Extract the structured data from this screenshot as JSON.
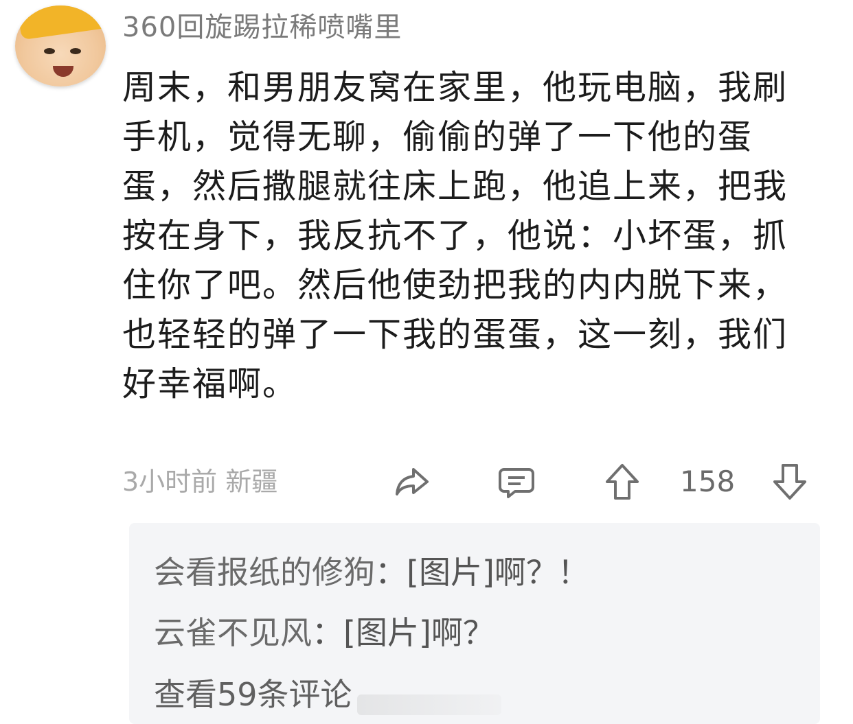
{
  "post": {
    "username": "360回旋踢拉稀喷嘴里",
    "text": "周末，和男朋友窝在家里，他玩电脑，我刷手机，觉得无聊，偷偷的弹了一下他的蛋蛋，然后撒腿就往床上跑，他追上来，把我按在身下，我反抗不了，他说：小坏蛋，抓住你了吧。然后他使劲把我的内内脱下来，也轻轻的弹了一下我的蛋蛋，这一刻，我们好幸福啊。",
    "time_location": "3小时前 新疆",
    "upvote_count": "158"
  },
  "icons": {
    "share": "share-arrow-icon",
    "comment": "comment-bubble-icon",
    "upvote": "up-arrow-icon",
    "downvote": "down-arrow-icon"
  },
  "comments": [
    {
      "author": "会看报纸的修狗",
      "separator": "：",
      "content": "[图片]啊？！"
    },
    {
      "author": "云雀不见风",
      "separator": "：",
      "content": "[图片]啊？"
    }
  ],
  "view_all_label": "查看59条评论"
}
